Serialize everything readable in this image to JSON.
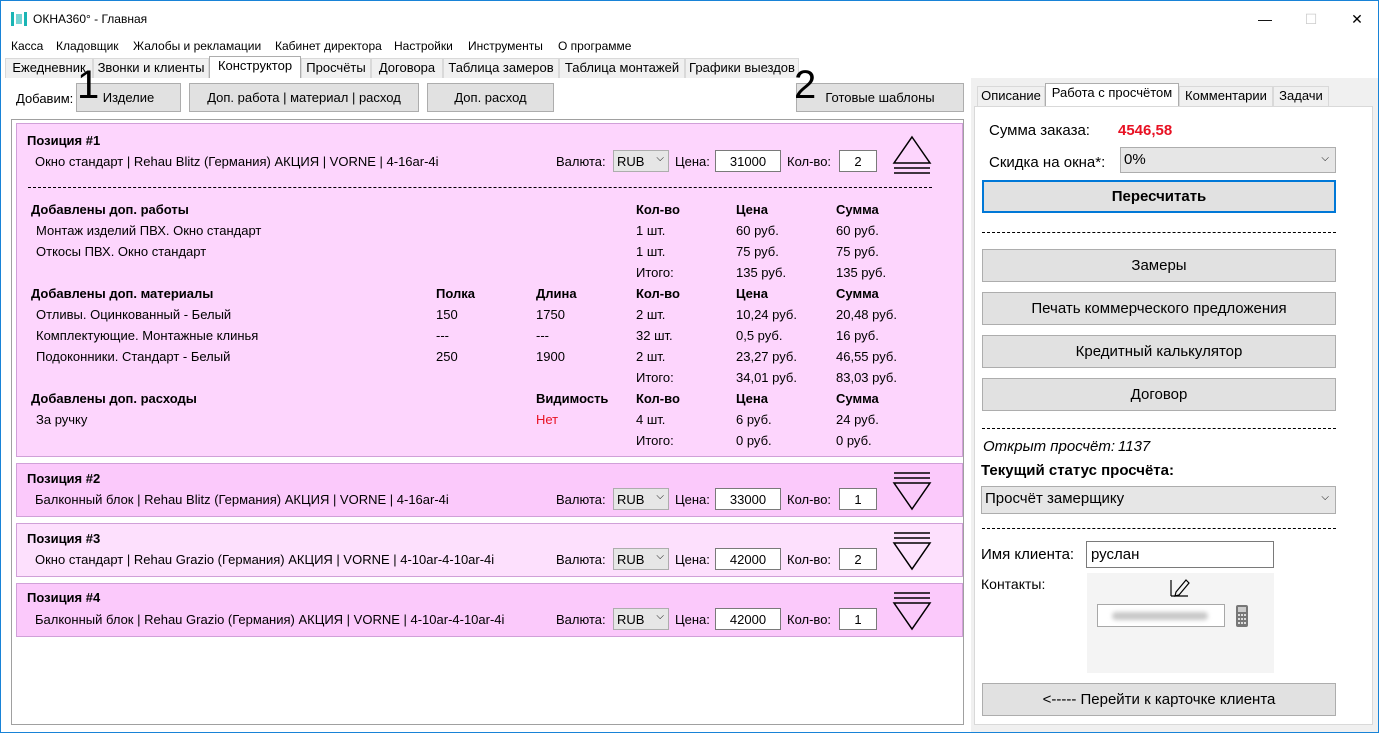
{
  "window": {
    "title": "ОКНА360° - Главная",
    "minimize": "—",
    "maximize": "☐",
    "close": "✕"
  },
  "menu": [
    "Касса",
    "Кладовщик",
    "Жалобы и рекламации",
    "Кабинет директора",
    "Настройки",
    "Инструменты",
    "О программе"
  ],
  "tabs": [
    "Ежедневник",
    "Звонки и клиенты",
    "Конструктор",
    "Просчёты",
    "Договора",
    "Таблица замеров",
    "Таблица монтажей",
    "Графики выездов"
  ],
  "toolbar": {
    "add_label": "Добавим:",
    "product": "Изделие",
    "extra_work": "Доп. работа | материал | расход",
    "extra_expense": "Доп. расход",
    "templates": "Готовые шаблоны"
  },
  "markers": {
    "one": "1",
    "two": "2"
  },
  "labels": {
    "currency": "Валюта:",
    "price": "Цена:",
    "qty": "Кол-во:"
  },
  "positions": [
    {
      "title": "Позиция #1",
      "desc": "Окно стандарт | Rehau Blitz (Германия) АКЦИЯ | VORNE | 4-16ar-4i",
      "currency": "RUB",
      "price": "31000",
      "qty": "2"
    },
    {
      "title": "Позиция #2",
      "desc": "Балконный блок | Rehau Blitz (Германия) АКЦИЯ | VORNE | 4-16ar-4i",
      "currency": "RUB",
      "price": "33000",
      "qty": "1"
    },
    {
      "title": "Позиция #3",
      "desc": "Окно стандарт | Rehau Grazio (Германия) АКЦИЯ | VORNE | 4-10ar-4-10ar-4i",
      "currency": "RUB",
      "price": "42000",
      "qty": "2"
    },
    {
      "title": "Позиция #4",
      "desc": "Балконный блок | Rehau Grazio (Германия) АКЦИЯ | VORNE | 4-10ar-4-10ar-4i",
      "currency": "RUB",
      "price": "42000",
      "qty": "1"
    }
  ],
  "works": {
    "heading": "Добавлены доп. работы",
    "cols": {
      "qty": "Кол-во",
      "price": "Цена",
      "sum": "Сумма"
    },
    "rows": [
      {
        "name": "Монтаж изделий ПВХ. Окно стандарт",
        "qty": "1 шт.",
        "price": "60 руб.",
        "sum": "60 руб."
      },
      {
        "name": "Откосы ПВХ. Окно стандарт",
        "qty": "1 шт.",
        "price": "75 руб.",
        "sum": "75 руб."
      }
    ],
    "total": {
      "label": "Итого:",
      "price": "135 руб.",
      "sum": "135 руб."
    }
  },
  "materials": {
    "heading": "Добавлены доп. материалы",
    "cols": {
      "shelf": "Полка",
      "length": "Длина",
      "qty": "Кол-во",
      "price": "Цена",
      "sum": "Сумма"
    },
    "rows": [
      {
        "name": "Отливы. Оцинкованный - Белый",
        "shelf": "150",
        "length": "1750",
        "qty": "2 шт.",
        "price": "10,24 руб.",
        "sum": "20,48 руб."
      },
      {
        "name": "Комплектующие. Монтажные клинья",
        "shelf": "---",
        "length": "---",
        "qty": "32 шт.",
        "price": "0,5 руб.",
        "sum": "16 руб."
      },
      {
        "name": "Подоконники. Стандарт - Белый",
        "shelf": "250",
        "length": "1900",
        "qty": "2 шт.",
        "price": "23,27 руб.",
        "sum": "46,55 руб."
      }
    ],
    "total": {
      "label": "Итого:",
      "price": "34,01 руб.",
      "sum": "83,03 руб."
    }
  },
  "expenses": {
    "heading": "Добавлены доп. расходы",
    "cols": {
      "visibility": "Видимость",
      "qty": "Кол-во",
      "price": "Цена",
      "sum": "Сумма"
    },
    "rows": [
      {
        "name": "За ручку",
        "visibility": "Нет",
        "qty": "4 шт.",
        "price": "6 руб.",
        "sum": "24 руб."
      }
    ],
    "total": {
      "label": "Итого:",
      "price": "0 руб.",
      "sum": "0 руб."
    }
  },
  "right": {
    "tabs": [
      "Описание",
      "Работа с просчётом",
      "Комментарии",
      "Задачи"
    ],
    "order_sum_label": "Сумма заказа:",
    "order_sum": "4546,58",
    "discount_label": "Скидка на окна*:",
    "discount": "0%",
    "recalc": "Пересчитать",
    "buttons": [
      "Замеры",
      "Печать коммерческого предложения",
      "Кредитный калькулятор",
      "Договор"
    ],
    "opened_label": "Открыт просчёт:",
    "opened_num": "1137",
    "status_label": "Текущий статус просчёта:",
    "status": "Просчёт замерщику",
    "client_label": "Имя клиента:",
    "client": "руслан",
    "contacts_label": "Контакты:",
    "go_client": "<----- Перейти к карточке клиента"
  },
  "colors": {
    "accent_red": "#e81123",
    "window_border": "#1883d7",
    "pos_pink": "#fdd5fd",
    "pos_pink_alt": "#fbc9fb"
  }
}
